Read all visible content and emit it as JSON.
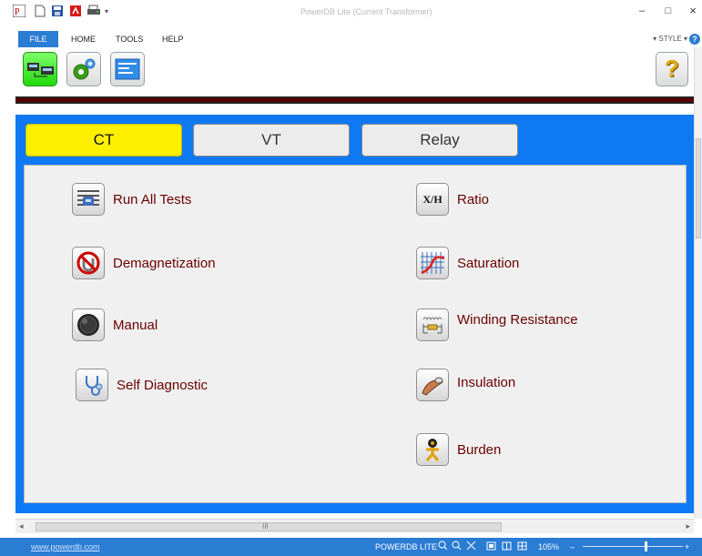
{
  "window": {
    "title": "PowerDB Lite (Current Transformer)",
    "minimize": "–",
    "maximize": "□",
    "close": "×"
  },
  "quick_access": {
    "items": [
      {
        "name": "app-logo-icon"
      },
      {
        "name": "new-document-icon"
      },
      {
        "name": "save-icon"
      },
      {
        "name": "pdf-icon"
      },
      {
        "name": "print-icon"
      },
      {
        "name": "customize-dropdown-icon"
      }
    ]
  },
  "menu": {
    "file": "FILE",
    "home": "HOME",
    "tools": "TOOLS",
    "help": "HELP",
    "style": "STYLE"
  },
  "toolbar": {
    "buttons": [
      {
        "name": "connect-instrument-button",
        "active": true
      },
      {
        "name": "settings-button",
        "active": false
      },
      {
        "name": "forms-button",
        "active": false
      }
    ],
    "help_label": "?"
  },
  "tabs": [
    {
      "label": "CT",
      "active": true
    },
    {
      "label": "VT",
      "active": false
    },
    {
      "label": "Relay",
      "active": false
    }
  ],
  "tests": {
    "left": [
      {
        "label": "Run All Tests",
        "icon": "run-all-tests-icon"
      },
      {
        "label": "Demagnetization",
        "icon": "demagnetization-icon"
      },
      {
        "label": "Manual",
        "icon": "manual-knob-icon"
      },
      {
        "label": "Self Diagnostic",
        "icon": "stethoscope-icon"
      }
    ],
    "right": [
      {
        "label": "Ratio",
        "icon": "ratio-icon",
        "icon_text": "X/H"
      },
      {
        "label": "Saturation",
        "icon": "saturation-curve-icon"
      },
      {
        "label": "Winding Resistance",
        "icon": "winding-resistance-icon"
      },
      {
        "label": "Insulation",
        "icon": "insulation-icon"
      },
      {
        "label": "Burden",
        "icon": "burden-icon"
      }
    ]
  },
  "scrollbar": {
    "grip": "III",
    "left_arrow": "◂",
    "right_arrow": "▸"
  },
  "status": {
    "website": "www.powerdb.com",
    "product": "POWERDB LITE",
    "zoom": "105%",
    "zoom_out": "–",
    "zoom_in": "+"
  },
  "colors": {
    "accent_blue": "#0f79f4",
    "active_tab": "#ffef00",
    "label_red": "#6a0000",
    "ribbon_blue": "#2b7cd3"
  }
}
